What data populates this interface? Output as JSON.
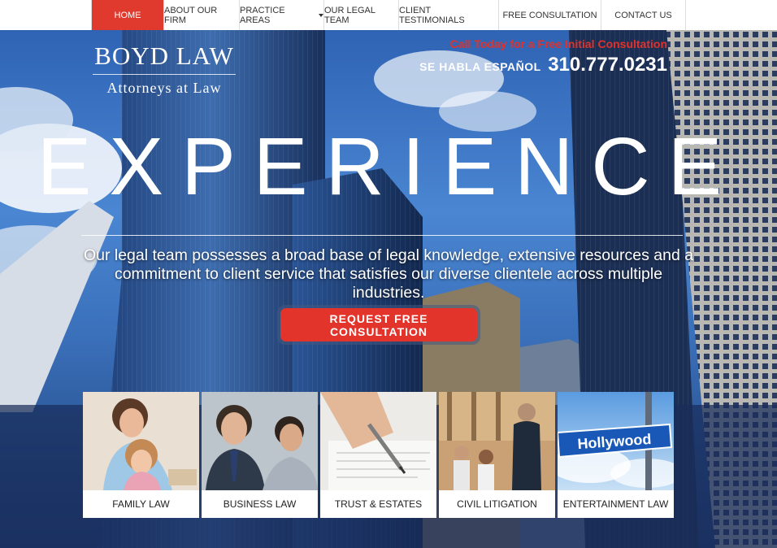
{
  "nav": {
    "items": [
      {
        "label": "HOME",
        "active": true
      },
      {
        "label": "ABOUT OUR FIRM"
      },
      {
        "label": "PRACTICE AREAS",
        "dropdown": true
      },
      {
        "label": "OUR LEGAL TEAM"
      },
      {
        "label": "CLIENT TESTIMONIALS"
      },
      {
        "label": "FREE CONSULTATION"
      },
      {
        "label": "CONTACT US"
      }
    ]
  },
  "logo": {
    "name": "BOYD LAW",
    "tagline": "Attorneys at Law"
  },
  "contact": {
    "call_text": "Call Today for a Free Initial Consultation",
    "spanish": "SE HABLA ESPAÑOL",
    "phone": "310.777.0231"
  },
  "hero": {
    "headline": "EXPERIENCE",
    "tagline": "Our legal team possesses a broad base of legal knowledge, extensive resources and a commitment to client service that satisfies our diverse clientele across multiple industries.",
    "button_label": "REQUEST FREE CONSULTATION"
  },
  "practice_areas": [
    {
      "label": "FAMILY LAW",
      "image": "family-photo"
    },
    {
      "label": "BUSINESS LAW",
      "image": "business-photo"
    },
    {
      "label": "TRUST & ESTATES",
      "image": "pen-document-photo"
    },
    {
      "label": "CIVIL LITIGATION",
      "image": "courtroom-photo"
    },
    {
      "label": "ENTERTAINMENT LAW",
      "image": "hollywood-sign-photo",
      "sign_text": "Hollywood"
    }
  ],
  "colors": {
    "accent_red": "#e03a2e",
    "sky_blue": "#4a86d2",
    "band_navy": "#192d5a"
  }
}
